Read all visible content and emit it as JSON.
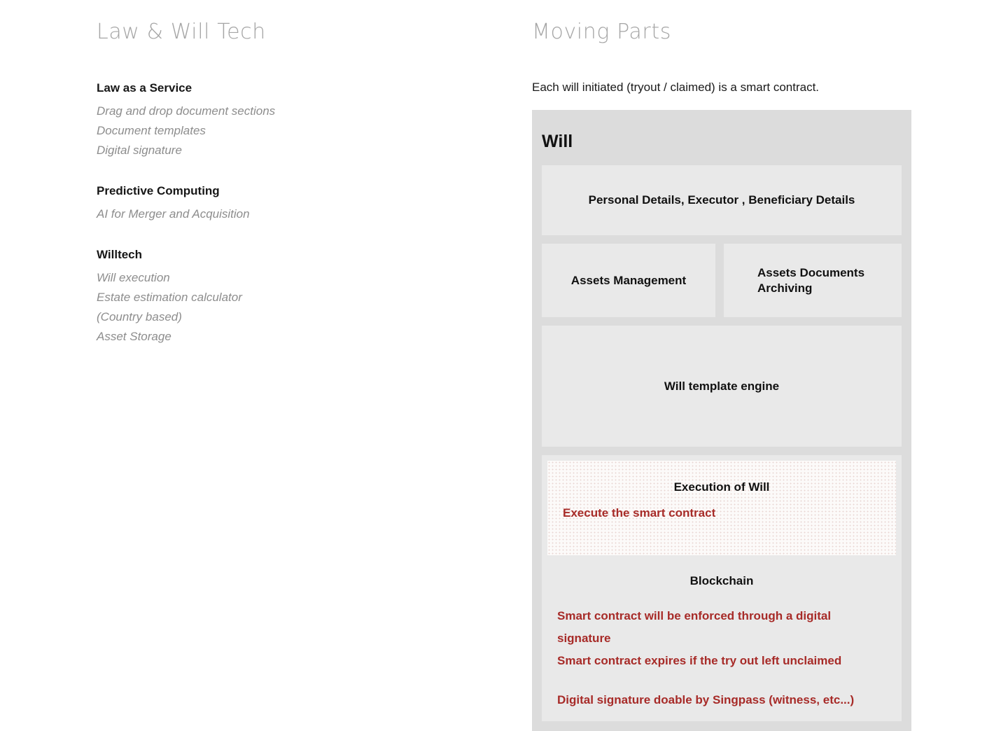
{
  "left": {
    "title": "Law & Will Tech",
    "groups": [
      {
        "heading": "Law as a Service",
        "items": [
          "Drag and drop document sections",
          "Document templates",
          "Digital signature"
        ]
      },
      {
        "heading": "Predictive Computing",
        "items": [
          "AI for Merger and Acquisition"
        ]
      },
      {
        "heading": "Willtech",
        "items": [
          "Will execution",
          "Estate estimation calculator (Country based)",
          "Asset Storage"
        ]
      }
    ]
  },
  "right": {
    "title": "Moving Parts",
    "lead": "Each will initiated (tryout / claimed) is a smart contract.",
    "panel": {
      "title": "Will",
      "personal_details": "Personal Details, Executor , Beneficiary Details",
      "assets_management": "Assets Management",
      "assets_documents_archiving": "Assets Documents Archiving",
      "will_template_engine": "Will template engine",
      "execution": {
        "title": "Execution of Will",
        "note": "Execute the smart contract"
      },
      "blockchain": {
        "title": "Blockchain",
        "notes": [
          "Smart contract will be enforced through a digital signature",
          "Smart contract expires if the try out left unclaimed",
          "Digital signature doable by Singpass (witness, etc...)"
        ]
      }
    }
  },
  "colors": {
    "panel_background": "#dcdcdc",
    "box_background": "#e9e9e9",
    "accent_red": "#a72b28",
    "muted_text": "#8d8d8d",
    "title_text": "#a6a6a6"
  }
}
